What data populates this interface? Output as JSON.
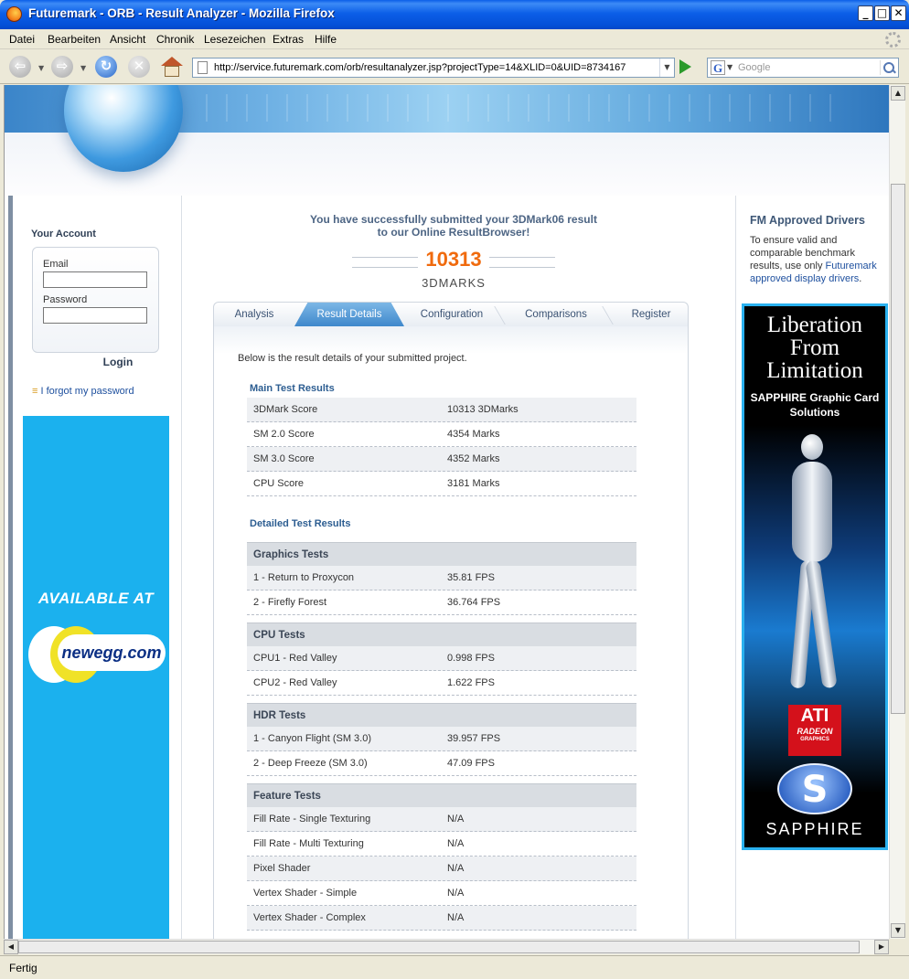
{
  "window": {
    "title": "Futuremark - ORB - Result Analyzer - Mozilla Firefox"
  },
  "menu": [
    "Datei",
    "Bearbeiten",
    "Ansicht",
    "Chronik",
    "Lesezeichen",
    "Extras",
    "Hilfe"
  ],
  "nav": {
    "url": "http://service.futuremark.com/orb/resultanalyzer.jsp?projectType=14&XLID=0&UID=8734167",
    "search_placeholder": "Google"
  },
  "status": "Fertig",
  "account": {
    "title": "Your Account",
    "email_label": "Email",
    "password_label": "Password",
    "login": "Login",
    "forgot": "I forgot my password"
  },
  "ads": {
    "left": {
      "available": "AVAILABLE AT",
      "brand": "newegg.com"
    },
    "right": {
      "headline": "Liberation From Limitation",
      "sub": "SAPPHIRE Graphic Card Solutions",
      "ati": "ATI",
      "radeon": "RADEON",
      "graphics": "GRAPHICS",
      "sapphire": "SAPPHIRE"
    }
  },
  "result": {
    "message_line1": "You have successfully submitted your 3DMark06 result",
    "message_line2": "to our Online ResultBrowser!",
    "score": "10313",
    "unit": "3DMARKS"
  },
  "tabs": [
    {
      "label": "Analysis",
      "active": false
    },
    {
      "label": "Result Details",
      "active": true
    },
    {
      "label": "Configuration",
      "active": false
    },
    {
      "label": "Comparisons",
      "active": false
    },
    {
      "label": "Register",
      "active": false
    }
  ],
  "details": {
    "intro": "Below is the result details of your submitted project.",
    "main_title": "Main Test Results",
    "main": [
      {
        "name": "3DMark Score",
        "value": "10313 3DMarks"
      },
      {
        "name": "SM 2.0 Score",
        "value": "4354 Marks"
      },
      {
        "name": "SM 3.0 Score",
        "value": "4352 Marks"
      },
      {
        "name": "CPU Score",
        "value": "3181 Marks"
      }
    ],
    "detailed_title": "Detailed Test Results",
    "groups": [
      {
        "title": "Graphics Tests",
        "rows": [
          {
            "name": "1 - Return to Proxycon",
            "value": "35.81 FPS"
          },
          {
            "name": "2 - Firefly Forest",
            "value": "36.764 FPS"
          }
        ]
      },
      {
        "title": "CPU Tests",
        "rows": [
          {
            "name": "CPU1 - Red Valley",
            "value": "0.998 FPS"
          },
          {
            "name": "CPU2 - Red Valley",
            "value": "1.622 FPS"
          }
        ]
      },
      {
        "title": "HDR Tests",
        "rows": [
          {
            "name": "1 - Canyon Flight (SM 3.0)",
            "value": "39.957 FPS"
          },
          {
            "name": "2 - Deep Freeze (SM 3.0)",
            "value": "47.09 FPS"
          }
        ]
      },
      {
        "title": "Feature Tests",
        "rows": [
          {
            "name": "Fill Rate - Single Texturing",
            "value": "N/A"
          },
          {
            "name": "Fill Rate - Multi Texturing",
            "value": "N/A"
          },
          {
            "name": "Pixel Shader",
            "value": "N/A"
          },
          {
            "name": "Vertex Shader - Simple",
            "value": "N/A"
          },
          {
            "name": "Vertex Shader - Complex",
            "value": "N/A"
          }
        ]
      }
    ]
  },
  "fm_drivers": {
    "title": "FM Approved Drivers",
    "text_pre": "To ensure valid and comparable benchmark results, use only ",
    "link": "Futuremark approved display drivers",
    "text_post": "."
  },
  "colors": {
    "score": "#f06a0d",
    "tab_active": "#3f88cc",
    "section_title": "#2c5d91",
    "ad_left_bg": "#1bb1ee",
    "ad_right_border": "#2ab1ef"
  }
}
